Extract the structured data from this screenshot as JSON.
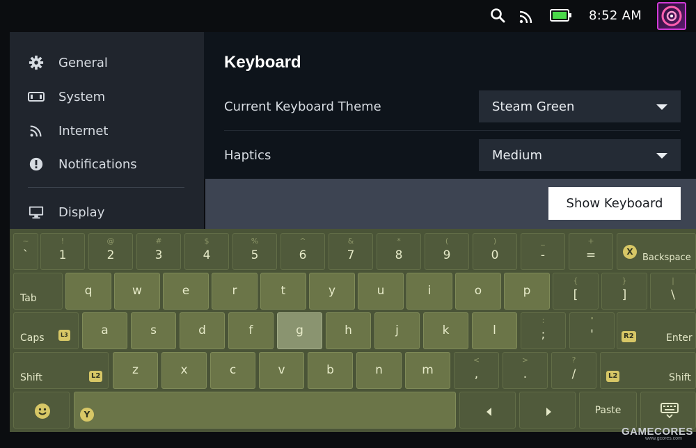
{
  "status_bar": {
    "time": "8:52 AM",
    "icons": [
      "search-icon",
      "rss-icon",
      "battery-icon",
      "avatar"
    ]
  },
  "sidebar": {
    "items": [
      {
        "label": "General",
        "icon": "gear-icon"
      },
      {
        "label": "System",
        "icon": "system-icon"
      },
      {
        "label": "Internet",
        "icon": "rss-icon"
      },
      {
        "label": "Notifications",
        "icon": "alert-icon"
      },
      {
        "label": "Display",
        "icon": "monitor-icon"
      }
    ]
  },
  "main": {
    "title": "Keyboard",
    "rows": [
      {
        "label": "Current Keyboard Theme",
        "value": "Steam Green"
      },
      {
        "label": "Haptics",
        "value": "Medium"
      }
    ],
    "show_keyboard_label": "Show Keyboard"
  },
  "keyboard": {
    "row1": [
      {
        "main": "`",
        "sub": "~"
      },
      {
        "main": "1",
        "sub": "!"
      },
      {
        "main": "2",
        "sub": "@"
      },
      {
        "main": "3",
        "sub": "#"
      },
      {
        "main": "4",
        "sub": "$"
      },
      {
        "main": "5",
        "sub": "%"
      },
      {
        "main": "6",
        "sub": "^"
      },
      {
        "main": "7",
        "sub": "&"
      },
      {
        "main": "8",
        "sub": "*"
      },
      {
        "main": "9",
        "sub": "("
      },
      {
        "main": "0",
        "sub": ")"
      },
      {
        "main": "-",
        "sub": "_"
      },
      {
        "main": "=",
        "sub": "+"
      }
    ],
    "backspace": {
      "label": "Backspace",
      "badge": "X"
    },
    "tab": "Tab",
    "row2": [
      {
        "main": "q"
      },
      {
        "main": "w"
      },
      {
        "main": "e"
      },
      {
        "main": "r"
      },
      {
        "main": "t"
      },
      {
        "main": "y"
      },
      {
        "main": "u"
      },
      {
        "main": "i"
      },
      {
        "main": "o"
      },
      {
        "main": "p"
      },
      {
        "main": "[",
        "sub": "{"
      },
      {
        "main": "]",
        "sub": "}"
      },
      {
        "main": "\\",
        "sub": "|"
      }
    ],
    "caps": {
      "label": "Caps",
      "badge": "L3"
    },
    "row3": [
      {
        "main": "a"
      },
      {
        "main": "s"
      },
      {
        "main": "d"
      },
      {
        "main": "f"
      },
      {
        "main": "g"
      },
      {
        "main": "h"
      },
      {
        "main": "j"
      },
      {
        "main": "k"
      },
      {
        "main": "l"
      },
      {
        "main": ";",
        "sub": ":"
      },
      {
        "main": "'",
        "sub": "\""
      }
    ],
    "enter": {
      "label": "Enter",
      "badge": "R2"
    },
    "shift_left": {
      "label": "Shift",
      "badge": "L2"
    },
    "row4": [
      {
        "main": "z"
      },
      {
        "main": "x"
      },
      {
        "main": "c"
      },
      {
        "main": "v"
      },
      {
        "main": "b"
      },
      {
        "main": "n"
      },
      {
        "main": "m"
      },
      {
        "main": ",",
        "sub": "<"
      },
      {
        "main": ".",
        "sub": ">"
      },
      {
        "main": "/",
        "sub": "?"
      }
    ],
    "shift_right": {
      "label": "Shift",
      "badge": "L2"
    },
    "space_badge": "Y",
    "paste": "Paste",
    "highlighted_key": "g"
  },
  "watermark": {
    "brand": "GAMECORES",
    "sub": "www.gcores.com"
  }
}
